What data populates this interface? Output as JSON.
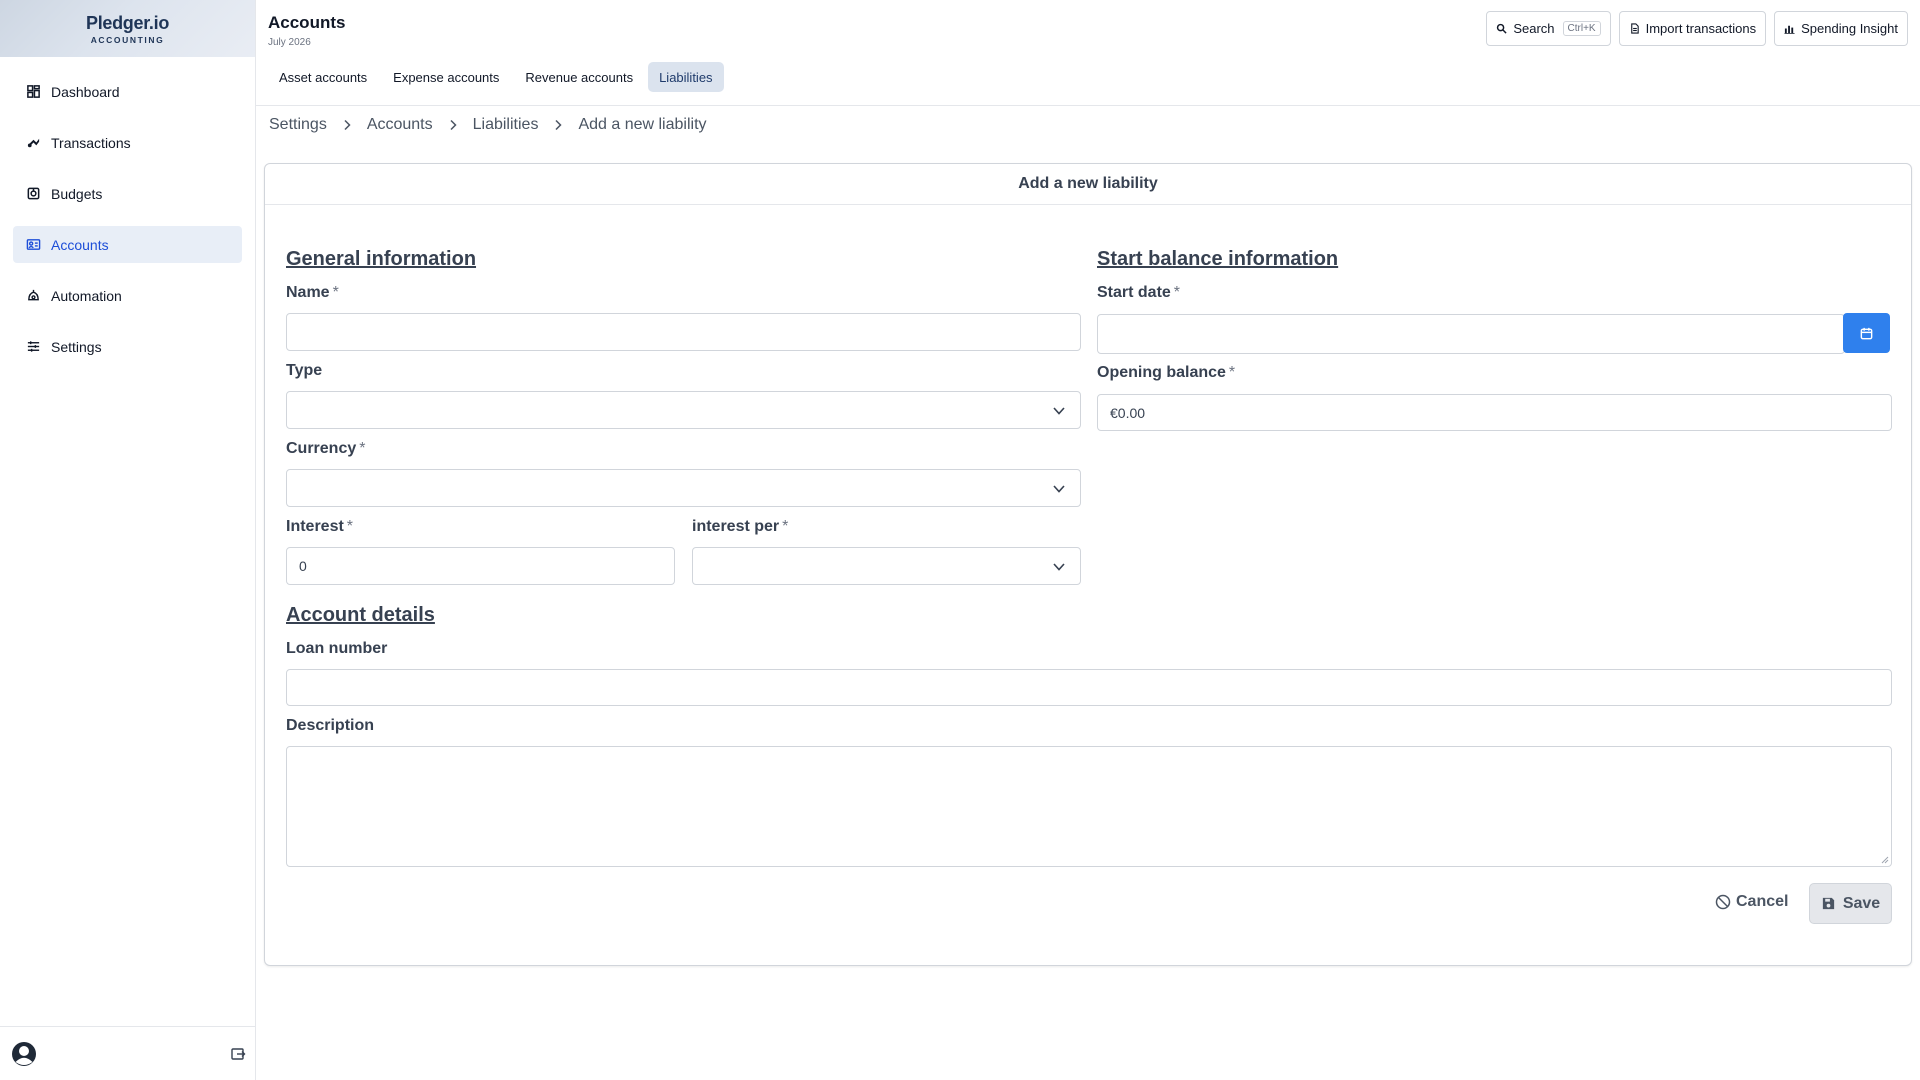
{
  "brand": {
    "name": "Pledger.io",
    "subtitle": "ACCOUNTING"
  },
  "sidebar": {
    "items": [
      {
        "label": "Dashboard",
        "icon": "dashboard-icon",
        "active": false
      },
      {
        "label": "Transactions",
        "icon": "transactions-icon",
        "active": false
      },
      {
        "label": "Budgets",
        "icon": "budgets-icon",
        "active": false
      },
      {
        "label": "Accounts",
        "icon": "accounts-icon",
        "active": true
      },
      {
        "label": "Automation",
        "icon": "automation-icon",
        "active": false
      },
      {
        "label": "Settings",
        "icon": "settings-icon",
        "active": false
      }
    ]
  },
  "header": {
    "title": "Accounts",
    "subtitle": "July 2026",
    "search_label": "Search",
    "search_shortcut": "Ctrl+K",
    "import_label": "Import transactions",
    "insight_label": "Spending Insight",
    "tabs": [
      {
        "label": "Asset accounts",
        "active": false
      },
      {
        "label": "Expense accounts",
        "active": false
      },
      {
        "label": "Revenue accounts",
        "active": false
      },
      {
        "label": "Liabilities",
        "active": true
      }
    ]
  },
  "breadcrumb": [
    "Settings",
    "Accounts",
    "Liabilities",
    "Add a new liability"
  ],
  "form": {
    "title": "Add a new liability",
    "general_title": "General information",
    "start_title": "Start balance information",
    "details_title": "Account details",
    "required_mark": "*",
    "name": {
      "label": "Name",
      "value": ""
    },
    "type": {
      "label": "Type",
      "value": ""
    },
    "currency": {
      "label": "Currency",
      "value": ""
    },
    "interest": {
      "label": "Interest",
      "value": "0"
    },
    "interest_per": {
      "label": "interest per",
      "value": ""
    },
    "start_date": {
      "label": "Start date",
      "value": ""
    },
    "opening_balance": {
      "label": "Opening balance",
      "value": "€0.00"
    },
    "loan_number": {
      "label": "Loan number",
      "value": ""
    },
    "description": {
      "label": "Description",
      "value": ""
    },
    "cancel_label": "Cancel",
    "save_label": "Save"
  },
  "colors": {
    "accent": "#2f80ed",
    "active_nav_bg": "#e8eef7",
    "active_tab_bg": "#dbe3ee"
  }
}
